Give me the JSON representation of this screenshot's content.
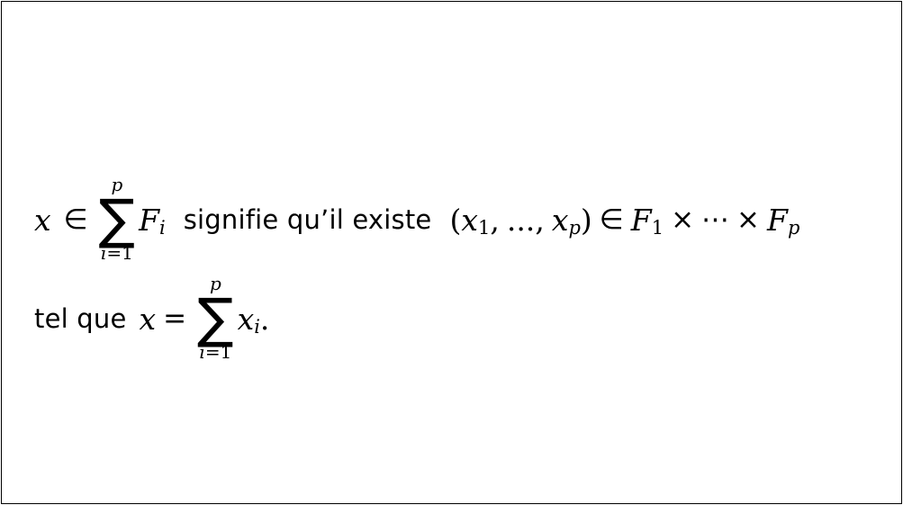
{
  "line1": {
    "x": "x",
    "in1": "∈",
    "sum_top": "p",
    "sum_sigma": "∑",
    "sum_bottom_var": "i",
    "sum_bottom_rest": "=1",
    "F": "F",
    "F_sub": "i",
    "text": "signifie qu’il existe",
    "open": "(",
    "x1": "x",
    "x1_sub": "1",
    "comma1": ",",
    "dots": "...",
    "comma2": ",",
    "xp": "x",
    "xp_sub": "p",
    "close": ")",
    "in2": "∈",
    "F1": "F",
    "F1_sub": "1",
    "times1": "×",
    "cdots": "⋯",
    "times2": "×",
    "Fp": "F",
    "Fp_sub": "p"
  },
  "line2": {
    "text": "tel que",
    "x": "x",
    "eq": "=",
    "sum_top": "p",
    "sum_sigma": "∑",
    "sum_bottom_var": "i",
    "sum_bottom_rest": "=1",
    "xi": "x",
    "xi_sub": "i",
    "period": "."
  }
}
